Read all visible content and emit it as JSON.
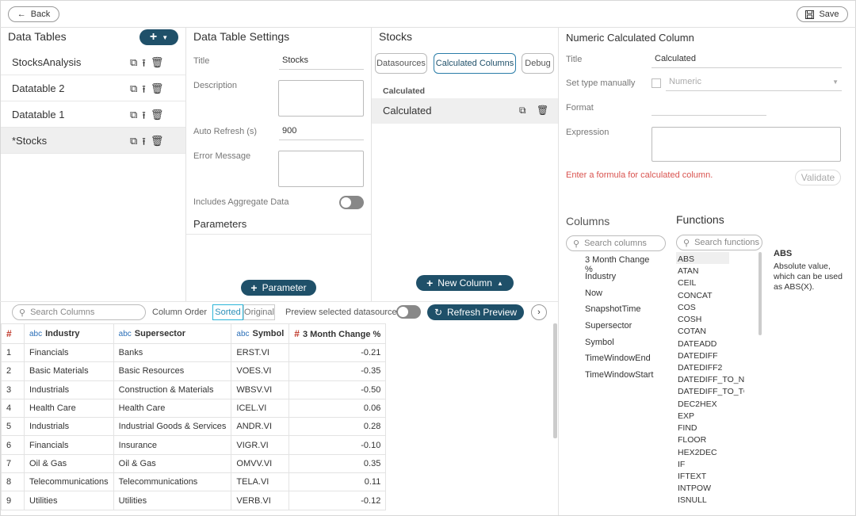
{
  "topbar": {
    "back_label": "Back",
    "save_label": "Save"
  },
  "data_tables": {
    "title": "Data Tables",
    "items": [
      {
        "label": "StocksAnalysis"
      },
      {
        "label": "Datatable 2"
      },
      {
        "label": "Datatable 1"
      },
      {
        "label": "*Stocks"
      }
    ]
  },
  "settings": {
    "title": "Data Table Settings",
    "title_label": "Title",
    "title_value": "Stocks",
    "description_label": "Description",
    "auto_refresh_label": "Auto Refresh (s)",
    "auto_refresh_value": "900",
    "error_label": "Error Message",
    "aggregate_label": "Includes Aggregate Data",
    "parameters_title": "Parameters",
    "parameter_button": "Parameter"
  },
  "stocks": {
    "title": "Stocks",
    "tabs": [
      "Datasources",
      "Calculated Columns",
      "Debug"
    ],
    "section_label": "Calculated",
    "row_label": "Calculated",
    "new_column_button": "New Column"
  },
  "numeric": {
    "title": "Numeric Calculated Column",
    "title_label": "Title",
    "title_value": "Calculated",
    "type_label": "Set type manually",
    "type_value": "Numeric",
    "format_label": "Format",
    "expression_label": "Expression",
    "error_text": "Enter a formula for calculated column.",
    "validate_label": "Validate",
    "columns_title": "Columns",
    "functions_title": "Functions",
    "columns_search_placeholder": "Search columns",
    "functions_search_placeholder": "Search functions",
    "columns": [
      "3 Month Change %",
      "Industry",
      "Now",
      "SnapshotTime",
      "Supersector",
      "Symbol",
      "TimeWindowEnd",
      "TimeWindowStart"
    ],
    "functions": [
      "ABS",
      "ATAN",
      "CEIL",
      "CONCAT",
      "COS",
      "COSH",
      "COTAN",
      "DATEADD",
      "DATEDIFF",
      "DATEDIFF2",
      "DATEDIFF_TO_NOW",
      "DATEDIFF_TO_TODAY",
      "DEC2HEX",
      "EXP",
      "FIND",
      "FLOOR",
      "HEX2DEC",
      "IF",
      "IFTEXT",
      "INTPOW",
      "ISNULL"
    ],
    "fn_help_title": "ABS",
    "fn_help_text": "Absolute value, which can be used as ABS(X)."
  },
  "preview": {
    "search_placeholder": "Search Columns",
    "column_order_label": "Column Order",
    "sorted_label": "Sorted",
    "original_label": "Original",
    "preview_label": "Preview selected datasource",
    "refresh_label": "Refresh Preview",
    "headers": [
      {
        "type": "#",
        "type_kind": "num",
        "name": ""
      },
      {
        "type": "abc",
        "type_kind": "str",
        "name": "Industry"
      },
      {
        "type": "abc",
        "type_kind": "str",
        "name": "Supersector"
      },
      {
        "type": "abc",
        "type_kind": "str",
        "name": "Symbol"
      },
      {
        "type": "#",
        "type_kind": "num",
        "name": "3 Month Change %"
      }
    ],
    "rows": [
      [
        "1",
        "Financials",
        "Banks",
        "ERST.VI",
        "-0.21"
      ],
      [
        "2",
        "Basic Materials",
        "Basic Resources",
        "VOES.VI",
        "-0.35"
      ],
      [
        "3",
        "Industrials",
        "Construction & Materials",
        "WBSV.VI",
        "-0.50"
      ],
      [
        "4",
        "Health Care",
        "Health Care",
        "ICEL.VI",
        "0.06"
      ],
      [
        "5",
        "Industrials",
        "Industrial Goods & Services",
        "ANDR.VI",
        "0.28"
      ],
      [
        "6",
        "Financials",
        "Insurance",
        "VIGR.VI",
        "-0.10"
      ],
      [
        "7",
        "Oil & Gas",
        "Oil & Gas",
        "OMVV.VI",
        "0.35"
      ],
      [
        "8",
        "Telecommunications",
        "Telecommunications",
        "TELA.VI",
        "0.11"
      ],
      [
        "9",
        "Utilities",
        "Utilities",
        "VERB.VI",
        "-0.12"
      ]
    ]
  },
  "colors": {
    "accent_dark": "#1f5069",
    "error": "#d9534f",
    "selection": "#efefef"
  }
}
